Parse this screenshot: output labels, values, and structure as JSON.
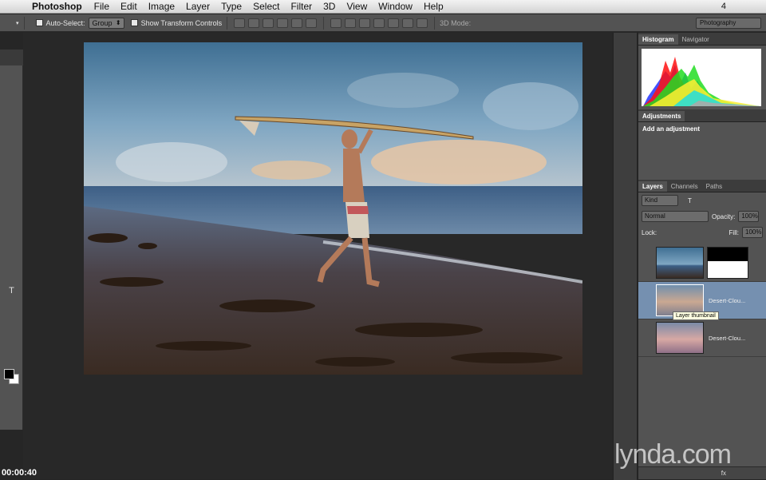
{
  "menubar": {
    "app_name": "Photoshop",
    "items": [
      "File",
      "Edit",
      "Image",
      "Layer",
      "Type",
      "Select",
      "Filter",
      "3D",
      "View",
      "Window",
      "Help"
    ],
    "status_count": "4"
  },
  "options": {
    "auto_select_label": "Auto-Select:",
    "auto_select_value": "Group",
    "transform_label": "Show Transform Controls",
    "mode_3d_label": "3D Mode:",
    "workspace": "Photography"
  },
  "panels": {
    "top_tabs": [
      "Histogram",
      "Navigator"
    ],
    "adjust_tab": "Adjustments",
    "adjust_title": "Add an adjustment",
    "layer_tabs": [
      "Layers",
      "Channels",
      "Paths"
    ],
    "kind_label": "Kind",
    "blend_mode": "Normal",
    "opacity_label": "Opacity:",
    "opacity_value": "100%",
    "lock_label": "Lock:",
    "fill_label": "Fill:",
    "fill_value": "100%"
  },
  "layers": [
    {
      "name": "",
      "mask": true,
      "visible": true
    },
    {
      "name": "Desert-Clou...",
      "mask": false,
      "visible": true,
      "selected": true
    },
    {
      "name": "Desert-Clou...",
      "mask": false,
      "visible": true
    }
  ],
  "tooltip": "Layer thumbnail",
  "timecode": "00:00:40",
  "watermark": "lynda.com",
  "colors": {
    "selected_layer": "#7590b0",
    "panel_bg": "#535353",
    "canvas_bg": "#282828"
  }
}
